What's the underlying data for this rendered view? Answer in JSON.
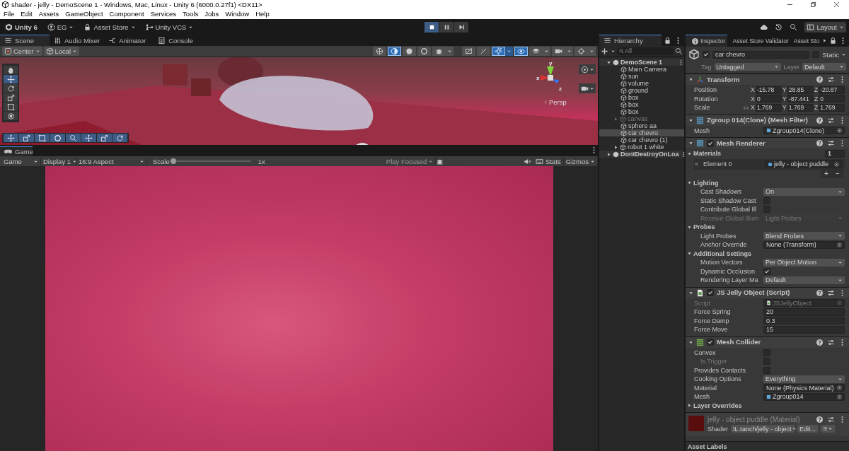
{
  "window": {
    "title": "shader - jelly - DemoScene 1 - Windows, Mac, Linux - Unity 6 (6000.0.27f1) <DX11>"
  },
  "menu": [
    "File",
    "Edit",
    "Assets",
    "GameObject",
    "Component",
    "Services",
    "Tools",
    "Jobs",
    "Window",
    "Help"
  ],
  "toolbar": {
    "account": "Unity 6",
    "org": "EG",
    "asset_store": "Asset Store",
    "vcs": "Unity VCS",
    "layout": "Layout",
    "play_buttons": [
      {
        "kind": "stop",
        "selected": true
      },
      {
        "kind": "pause",
        "selected": false
      },
      {
        "kind": "step",
        "selected": false
      }
    ]
  },
  "scene_tabs": [
    {
      "label": "Scene",
      "kind": "list",
      "selected": true
    },
    {
      "label": "Audio Mixer",
      "kind": "sliders",
      "selected": false
    },
    {
      "label": "Animator",
      "kind": "connector",
      "selected": false
    },
    {
      "label": "Console",
      "kind": "console",
      "selected": false
    }
  ],
  "scene_toolbar": {
    "pivot": "Center",
    "space": "Local",
    "buttons": [
      {
        "kind": "grid",
        "selected": false
      },
      {
        "kind": "half",
        "selected": true
      },
      {
        "kind": "dot",
        "selected": false
      },
      {
        "kind": "ring",
        "selected": false
      },
      {
        "kind": "bug",
        "selected": false
      },
      {
        "kind": "crossed",
        "selected": false
      },
      {
        "kind": "crossed2",
        "selected": false
      },
      {
        "kind": "sparkle",
        "selected": true
      },
      {
        "kind": "eye",
        "selected": true
      },
      {
        "kind": "layers",
        "selected": false
      },
      {
        "kind": "camera",
        "selected": false
      },
      {
        "kind": "gizmo",
        "selected": false
      }
    ]
  },
  "scene_view": {
    "tools": [
      {
        "kind": "hand",
        "selected": false
      },
      {
        "kind": "move",
        "selected": true
      },
      {
        "kind": "rotate",
        "selected": false
      },
      {
        "kind": "scale",
        "selected": false
      },
      {
        "kind": "rect",
        "selected": false
      },
      {
        "kind": "transform",
        "selected": false
      }
    ],
    "overlay_tools": [
      {
        "kind": "move",
        "selected": true
      },
      {
        "kind": "scale",
        "selected": true
      },
      {
        "kind": "rect",
        "selected": true
      },
      {
        "kind": "ring",
        "selected": true
      },
      {
        "kind": "search",
        "selected": true
      },
      {
        "kind": "move",
        "selected": true
      },
      {
        "kind": "scale",
        "selected": true
      },
      {
        "kind": "rotate",
        "selected": true
      }
    ],
    "axis_labels": [
      "y",
      "x",
      "z"
    ],
    "projection": "Persp"
  },
  "game_tab": {
    "label": "Game"
  },
  "game_toolbar": {
    "mode": "Game",
    "display": "Display 1",
    "aspect": "16:9 Aspect",
    "scale_label": "Scale",
    "level": 0,
    "scale_value": "1x",
    "play_mode": "Play Focused",
    "stats": "Stats",
    "gizmos": "Gizmos"
  },
  "hierarchy": {
    "title": "Hierarchy",
    "search_placeholder": "All",
    "items": [
      {
        "label": "DemoScene 1",
        "kind": "scene",
        "expanded": true,
        "children": [
          {
            "label": "Main Camera",
            "kind": "object",
            "selected": false,
            "disabled": false
          },
          {
            "label": "sun",
            "kind": "object",
            "selected": false,
            "disabled": false
          },
          {
            "label": "volume",
            "kind": "object",
            "selected": false,
            "disabled": false
          },
          {
            "label": "ground",
            "kind": "object",
            "selected": false,
            "disabled": false
          },
          {
            "label": "box",
            "kind": "object",
            "selected": false,
            "disabled": false
          },
          {
            "label": "box",
            "kind": "object",
            "selected": false,
            "disabled": false
          },
          {
            "label": "box",
            "kind": "object",
            "selected": false,
            "disabled": false
          },
          {
            "label": "canvas",
            "kind": "parent",
            "selected": false,
            "disabled": true
          },
          {
            "label": "sphere aa",
            "kind": "object",
            "selected": false,
            "disabled": false
          },
          {
            "label": "car chevro",
            "kind": "object",
            "selected": true,
            "disabled": false
          },
          {
            "label": "car chevro (1)",
            "kind": "object",
            "selected": false,
            "disabled": false
          },
          {
            "label": "robot 1 white",
            "kind": "parent",
            "selected": false,
            "disabled": false
          }
        ]
      },
      {
        "label": "DontDestroyOnLoa",
        "kind": "scene",
        "expanded": false
      }
    ]
  },
  "inspector": {
    "tabs": [
      {
        "label": "Inspector",
        "selected": true
      },
      {
        "label": "Asset Store Validator",
        "selected": false
      },
      {
        "label": "Asset Sto",
        "selected": false
      }
    ],
    "object": {
      "active": true,
      "name": "car chevro",
      "static": false,
      "static_label": "Static",
      "tag_label": "Tag",
      "tag": "Untagged",
      "layer_label": "Layer",
      "layer": "Default"
    },
    "components": [
      {
        "kind": "transform",
        "title": "Transform",
        "rows": [
          {
            "kind": "vector",
            "label": "Position",
            "disabled": false,
            "values": [
              {
                "axis": "X",
                "value": "-15.78"
              },
              {
                "axis": "Y",
                "value": "28.85"
              },
              {
                "axis": "Z",
                "value": "-20.87"
              }
            ]
          },
          {
            "kind": "vector",
            "label": "Rotation",
            "disabled": false,
            "values": [
              {
                "axis": "X",
                "value": "0"
              },
              {
                "axis": "Y",
                "value": "-87.441"
              },
              {
                "axis": "Z",
                "value": "0"
              }
            ]
          },
          {
            "kind": "scale",
            "label": "Scale",
            "disabled": false,
            "values": [
              {
                "axis": "X",
                "value": "1.769"
              },
              {
                "axis": "Y",
                "value": "1.769"
              },
              {
                "axis": "Z",
                "value": "1.769"
              }
            ]
          }
        ]
      },
      {
        "kind": "mesh_filter",
        "title": "Zgroup 014(Clone) (Mesh Filter)",
        "rows": [
          {
            "kind": "mesh_object",
            "label": "Mesh",
            "value": "Zgroup014(Clone)",
            "disabled": false
          }
        ]
      },
      {
        "kind": "mesh_renderer",
        "title": "Mesh Renderer",
        "enabled": true,
        "rows": [
          {
            "kind": "section",
            "label": "Materials",
            "count": "1",
            "expanded": true,
            "rows": [
              {
                "kind": "element",
                "label": "Element 0",
                "value": "jelly - object puddle",
                "disabled": false
              },
              {
                "kind": "buttons",
                "labels": [
                  "+",
                  "−"
                ]
              }
            ]
          },
          {
            "kind": "section",
            "label": "Lighting",
            "expanded": true,
            "rows": [
              {
                "kind": "dropdown",
                "label": "Cast Shadows",
                "value": "On",
                "disabled": false
              },
              {
                "kind": "checkbox",
                "label": "Static Shadow Cast",
                "checked": false,
                "disabled": false
              },
              {
                "kind": "checkbox",
                "label": "Contribute Global Ill",
                "checked": false,
                "disabled": false
              },
              {
                "kind": "dropdown",
                "label": "Receive Global Illum",
                "value": "Light Probes",
                "disabled": true
              }
            ]
          },
          {
            "kind": "section",
            "label": "Probes",
            "expanded": true,
            "rows": [
              {
                "kind": "dropdown",
                "label": "Light Probes",
                "value": "Blend Probes",
                "disabled": false
              },
              {
                "kind": "object",
                "label": "Anchor Override",
                "value": "None (Transform)",
                "disabled": false
              }
            ]
          },
          {
            "kind": "section",
            "label": "Additional Settings",
            "expanded": true,
            "rows": [
              {
                "kind": "dropdown",
                "label": "Motion Vectors",
                "value": "Per Object Motion",
                "disabled": false
              },
              {
                "kind": "checkbox",
                "label": "Dynamic Occlusion",
                "checked": true,
                "disabled": false
              },
              {
                "kind": "dropdown",
                "label": "Rendering Layer Ma",
                "value": "Default",
                "disabled": false
              }
            ]
          }
        ]
      },
      {
        "kind": "script",
        "title": "JS Jelly Object (Script)",
        "enabled": true,
        "rows": [
          {
            "kind": "script_object",
            "label": "Script",
            "value": "JSJellyObject",
            "disabled": true
          },
          {
            "kind": "number",
            "label": "Force Spring",
            "value": "20",
            "disabled": false
          },
          {
            "kind": "number",
            "label": "Force Damp",
            "value": "0.3",
            "disabled": false
          },
          {
            "kind": "number",
            "label": "Force Move",
            "value": "15",
            "disabled": false
          }
        ]
      },
      {
        "kind": "mesh_collider",
        "title": "Mesh Collider",
        "enabled": true,
        "rows": [
          {
            "kind": "checkbox",
            "label": "Convex",
            "checked": false,
            "disabled": false,
            "rows": [
              {
                "kind": "checkbox",
                "label": "Is Trigger",
                "checked": false,
                "disabled": true
              }
            ]
          },
          {
            "kind": "checkbox",
            "label": "Provides Contacts",
            "checked": false,
            "disabled": false
          },
          {
            "kind": "dropdown",
            "label": "Cooking Options",
            "value": "Everything",
            "disabled": false
          },
          {
            "kind": "object",
            "label": "Material",
            "value": "None (Physics Material)",
            "disabled": false
          },
          {
            "kind": "mesh_object",
            "label": "Mesh",
            "value": "Zgroup014",
            "disabled": false
          },
          {
            "kind": "section",
            "label": "Layer Overrides",
            "expanded": false
          }
        ]
      }
    ],
    "material": {
      "title": "jelly - object puddle (Material)",
      "shader_label": "Shader",
      "shader": "IL.ranch/jelly - object",
      "edit": "Edit..."
    },
    "footer": "Asset Labels"
  }
}
